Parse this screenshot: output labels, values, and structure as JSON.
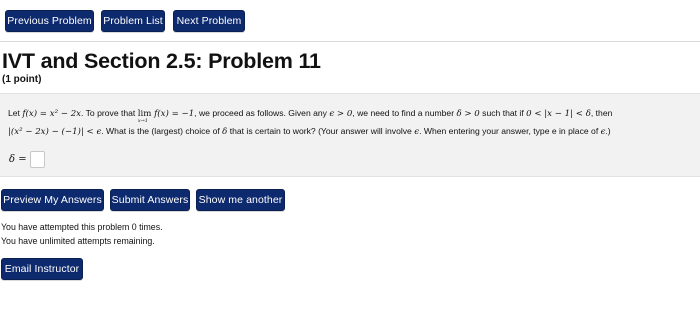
{
  "nav": {
    "previous_label": "Previous Problem",
    "list_label": "Problem List",
    "next_label": "Next Problem"
  },
  "problem": {
    "title": "IVT and Section 2.5: Problem 11",
    "points": "(1 point)",
    "text": {
      "let": "Let ",
      "fx_def": "f(x) = x² − 2x",
      "to_prove": ". To prove that ",
      "lim": "lim",
      "lim_sub": "x→1",
      "lim_rest": " f(x) = −1",
      "proceed": ", we proceed as follows. Given any ",
      "eps_pos": "ϵ > 0",
      "need": ", we need to find a number ",
      "delta_pos": "δ > 0",
      "such_that": " such that if ",
      "cond": "0 < |x − 1| < δ",
      "then": ", then",
      "abs_expr": "|(x² − 2x) − (−1)| < ϵ",
      "question": ". What is the (largest) choice of ",
      "delta": "δ",
      "will_work": " that is certain to work? (Your answer will involve ",
      "eps": "ϵ",
      "entering": ". When entering your answer, type e in place of ",
      "eps_end": "ϵ",
      "close": ".)"
    },
    "answer_label": "δ =",
    "answer_value": ""
  },
  "actions": {
    "preview_label": "Preview My Answers",
    "submit_label": "Submit Answers",
    "another_label": "Show me another"
  },
  "status": {
    "attempted": "You have attempted this problem 0 times.",
    "remaining": "You have unlimited attempts remaining."
  },
  "email_label": "Email Instructor",
  "colors": {
    "button_bg": "#0e2a6e",
    "button_text": "#ffffff",
    "problem_bg": "#f2f2f2"
  }
}
